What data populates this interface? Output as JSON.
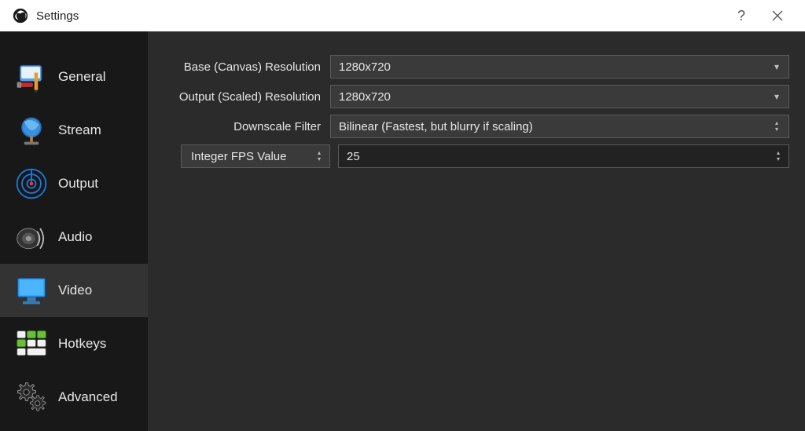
{
  "window": {
    "title": "Settings",
    "help_glyph": "?",
    "close_glyph": "×"
  },
  "sidebar": {
    "items": [
      {
        "key": "general",
        "label": "General"
      },
      {
        "key": "stream",
        "label": "Stream"
      },
      {
        "key": "output",
        "label": "Output"
      },
      {
        "key": "audio",
        "label": "Audio"
      },
      {
        "key": "video",
        "label": "Video"
      },
      {
        "key": "hotkeys",
        "label": "Hotkeys"
      },
      {
        "key": "advanced",
        "label": "Advanced"
      }
    ],
    "selected_key": "video"
  },
  "form": {
    "base_resolution": {
      "label": "Base (Canvas) Resolution",
      "value": "1280x720"
    },
    "output_resolution": {
      "label": "Output (Scaled) Resolution",
      "value": "1280x720"
    },
    "downscale_filter": {
      "label": "Downscale Filter",
      "value": "Bilinear (Fastest, but blurry if scaling)"
    },
    "fps": {
      "label": "Integer FPS Value",
      "value": "25"
    }
  }
}
